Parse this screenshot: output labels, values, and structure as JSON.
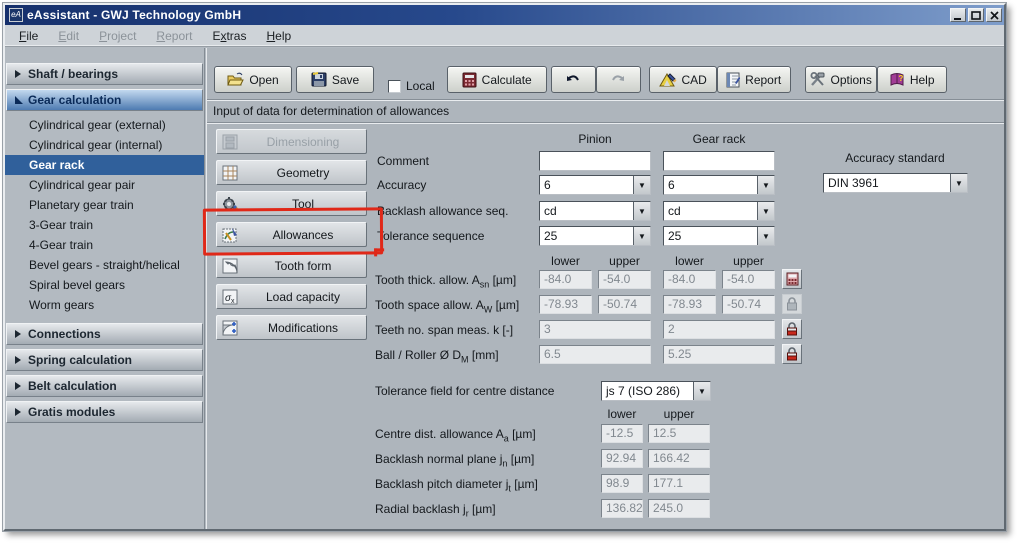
{
  "window": {
    "title": "eAssistant - GWJ Technology GmbH",
    "icon_text": "eA"
  },
  "menu": {
    "items": [
      {
        "pre": "",
        "u": "F",
        "post": "ile",
        "enabled": true
      },
      {
        "pre": "",
        "u": "E",
        "post": "dit",
        "enabled": false
      },
      {
        "pre": "",
        "u": "P",
        "post": "roject",
        "enabled": false
      },
      {
        "pre": "",
        "u": "R",
        "post": "eport",
        "enabled": false
      },
      {
        "pre": "E",
        "u": "x",
        "post": "tras",
        "enabled": true
      },
      {
        "pre": "",
        "u": "H",
        "post": "elp",
        "enabled": true
      }
    ]
  },
  "toolbar": {
    "open": "Open",
    "save": "Save",
    "local": "Local",
    "calculate": "Calculate",
    "cad": "CAD",
    "report": "Report",
    "options": "Options",
    "help": "Help",
    "local_checked": false
  },
  "subtitle": "Input of data for determination of allowances",
  "sidebar": {
    "selected": "Gear rack",
    "groups": [
      {
        "label": "Shaft / bearings"
      },
      {
        "label": "Gear calculation",
        "items": [
          "Cylindrical gear (external)",
          "Cylindrical gear (internal)",
          "Gear rack",
          "Cylindrical gear pair",
          "Planetary gear train",
          "3-Gear train",
          "4-Gear train",
          "Bevel gears - straight/helical",
          "Spiral bevel gears",
          "Worm gears"
        ]
      },
      {
        "label": "Connections"
      },
      {
        "label": "Spring calculation"
      },
      {
        "label": "Belt calculation"
      },
      {
        "label": "Gratis modules"
      }
    ]
  },
  "nav": {
    "buttons": [
      {
        "label": "Dimensioning",
        "enabled": false
      },
      {
        "label": "Geometry",
        "enabled": true
      },
      {
        "label": "Tool",
        "enabled": true
      },
      {
        "label": "Allowances",
        "enabled": true
      },
      {
        "label": "Tooth form",
        "enabled": true
      },
      {
        "label": "Load capacity",
        "enabled": true
      },
      {
        "label": "Modifications",
        "enabled": true
      }
    ]
  },
  "form": {
    "columns": {
      "pinion": "Pinion",
      "gear_rack": "Gear rack"
    },
    "accuracy_standard": {
      "label": "Accuracy standard",
      "value": "DIN 3961"
    },
    "rows": {
      "comment": {
        "label": "Comment",
        "pinion": "",
        "gear_rack": ""
      },
      "accuracy": {
        "label": "Accuracy",
        "pinion": "6",
        "gear_rack": "6"
      },
      "backlash_seq": {
        "label": "Backlash allowance seq.",
        "pinion": "cd",
        "gear_rack": "cd"
      },
      "tolerance_seq": {
        "label": "Tolerance sequence",
        "pinion": "25",
        "gear_rack": "25"
      }
    },
    "allowances": {
      "col_headers": [
        "lower",
        "upper",
        "lower",
        "upper"
      ],
      "rows": [
        {
          "label_main": "Tooth thick. allow. A",
          "label_sub": "sn",
          "label_unit": " [µm]",
          "values": [
            "-84.0",
            "-54.0",
            "-84.0",
            "-54.0"
          ],
          "icon": "calculator"
        },
        {
          "label_main": "Tooth space allow. A",
          "label_sub": "W",
          "label_unit": " [µm]",
          "values": [
            "-78.93",
            "-50.74",
            "-78.93",
            "-50.74"
          ],
          "icon": "lock-gray"
        },
        {
          "label_main": "Teeth no. span meas. k [-]",
          "label_sub": "",
          "label_unit": "",
          "values": [
            "3",
            "2"
          ],
          "icon": "lock-red"
        },
        {
          "label_main": "Ball / Roller Ø D",
          "label_sub": "M",
          "label_unit": " [mm]",
          "values": [
            "6.5",
            "5.25"
          ],
          "icon": "lock-red"
        }
      ]
    },
    "centre": {
      "tol_label": "Tolerance field for centre distance",
      "tol_value": "js 7 (ISO 286)",
      "col_headers": [
        "lower",
        "upper"
      ],
      "rows": [
        {
          "label_main": "Centre dist. allowance A",
          "label_sub": "a",
          "label_unit": " [µm]",
          "lower": "-12.5",
          "upper": "12.5"
        },
        {
          "label_main": "Backlash normal plane j",
          "label_sub": "n",
          "label_unit": " [µm]",
          "lower": "92.94",
          "upper": "166.42"
        },
        {
          "label_main": "Backlash pitch diameter j",
          "label_sub": "t",
          "label_unit": " [µm]",
          "lower": "98.9",
          "upper": "177.1"
        },
        {
          "label_main": "Radial backlash j",
          "label_sub": "r",
          "label_unit": " [µm]",
          "lower": "136.82",
          "upper": "245.0"
        }
      ]
    }
  },
  "icons": {
    "dropdown": "▼"
  },
  "colors": {
    "selected_item": "#30609B",
    "annotation": "#E02818",
    "titlebar_left": "#16306C",
    "titlebar_right": "#7E9DCB"
  },
  "annotation": {
    "shape": "hand-drawn rectangle",
    "target": "Allowances button"
  }
}
